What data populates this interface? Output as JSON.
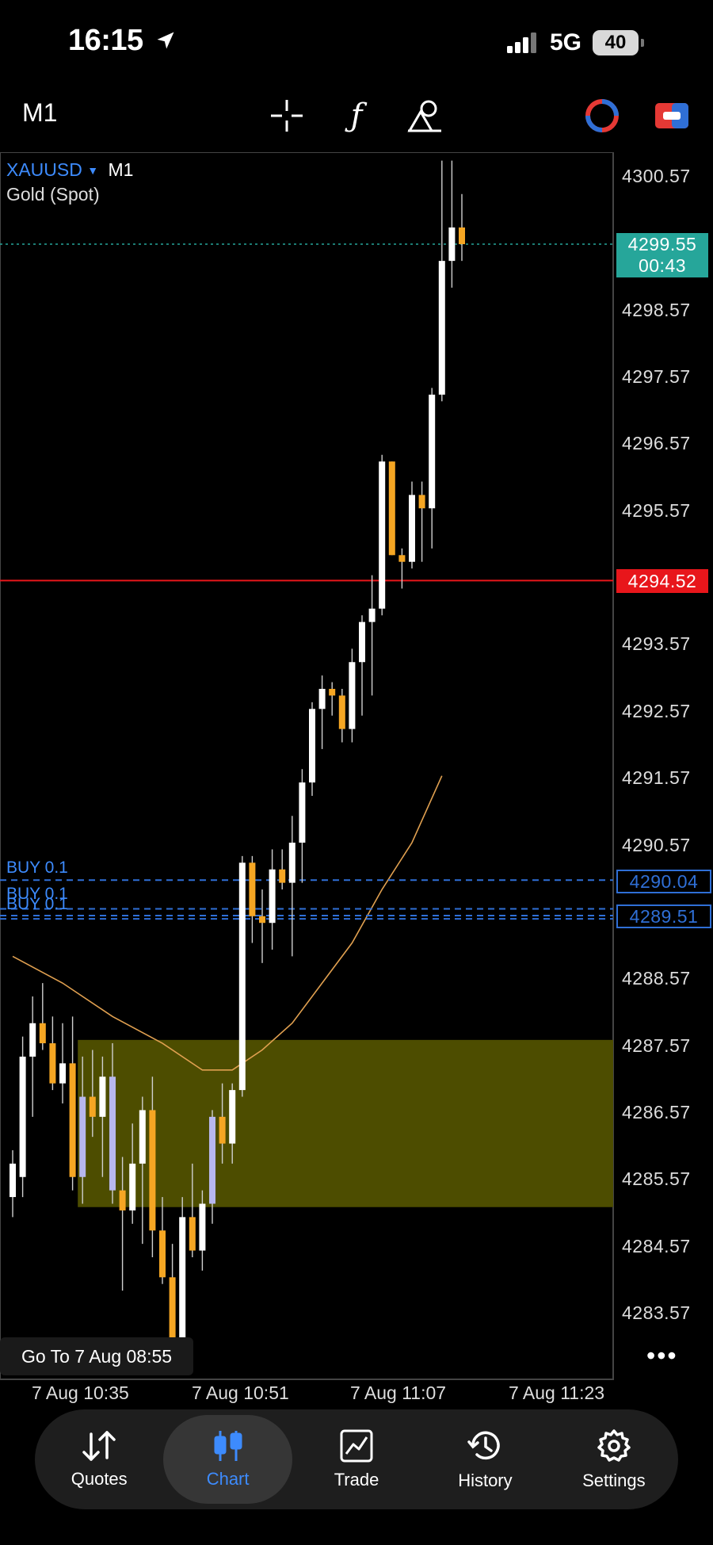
{
  "status_bar": {
    "time": "16:15",
    "network": "5G",
    "battery": "40"
  },
  "toolbar": {
    "timeframe": "M1"
  },
  "chart": {
    "symbol": "XAUUSD",
    "symbol_timeframe": "M1",
    "description": "Gold (Spot)",
    "bid_price": "4299.55",
    "countdown": "00:43",
    "red_line_price": "4294.52",
    "order_price_1": "4290.04",
    "order_price_2": "4289.51",
    "buy_labels": [
      "BUY 0.1",
      "BUY 0.1",
      "BUY 0.1"
    ],
    "goto_label": "Go To 7 Aug 08:55",
    "y_labels": [
      "4300.57",
      "4298.57",
      "4297.57",
      "4296.57",
      "4295.57",
      "4293.57",
      "4292.57",
      "4291.57",
      "4290.57",
      "4288.57",
      "4287.57",
      "4286.57",
      "4285.57",
      "4284.57",
      "4283.57"
    ],
    "x_labels": [
      "7 Aug 10:35",
      "7 Aug 10:51",
      "7 Aug 11:07",
      "7 Aug 11:23"
    ],
    "colors": {
      "bull": "#ffffff",
      "bear": "#f5a623",
      "neutral": "#b7b7ee",
      "zone": "#4d4d00",
      "red_line": "#e8161b",
      "bid_line": "#26a69a",
      "order_line": "#2f6fd6"
    }
  },
  "chart_data": {
    "type": "candlestick",
    "symbol": "XAUUSD",
    "timeframe": "M1",
    "ylim": [
      4283.0,
      4301.2
    ],
    "candles": [
      {
        "o": 4285.3,
        "h": 4286.0,
        "l": 4285.0,
        "c": 4285.8
      },
      {
        "o": 4285.6,
        "h": 4287.7,
        "l": 4285.3,
        "c": 4287.4
      },
      {
        "o": 4287.4,
        "h": 4288.3,
        "l": 4286.5,
        "c": 4287.9
      },
      {
        "o": 4287.9,
        "h": 4288.5,
        "l": 4287.5,
        "c": 4287.6
      },
      {
        "o": 4287.6,
        "h": 4288.0,
        "l": 4286.9,
        "c": 4287.0
      },
      {
        "o": 4287.0,
        "h": 4287.9,
        "l": 4286.7,
        "c": 4287.3
      },
      {
        "o": 4287.3,
        "h": 4288.0,
        "l": 4285.4,
        "c": 4285.6
      },
      {
        "o": 4285.6,
        "h": 4287.4,
        "l": 4285.2,
        "c": 4286.8
      },
      {
        "o": 4286.8,
        "h": 4287.5,
        "l": 4286.2,
        "c": 4286.5
      },
      {
        "o": 4286.5,
        "h": 4287.4,
        "l": 4285.6,
        "c": 4287.1
      },
      {
        "o": 4287.1,
        "h": 4287.6,
        "l": 4285.2,
        "c": 4285.4
      },
      {
        "o": 4285.4,
        "h": 4285.9,
        "l": 4283.9,
        "c": 4285.1
      },
      {
        "o": 4285.1,
        "h": 4286.4,
        "l": 4284.9,
        "c": 4285.8
      },
      {
        "o": 4285.8,
        "h": 4286.8,
        "l": 4284.6,
        "c": 4286.6
      },
      {
        "o": 4286.6,
        "h": 4287.1,
        "l": 4284.4,
        "c": 4284.8
      },
      {
        "o": 4284.8,
        "h": 4285.3,
        "l": 4284.0,
        "c": 4284.1
      },
      {
        "o": 4284.1,
        "h": 4284.6,
        "l": 4283.0,
        "c": 4283.2
      },
      {
        "o": 4283.2,
        "h": 4285.3,
        "l": 4283.0,
        "c": 4285.0
      },
      {
        "o": 4285.0,
        "h": 4285.8,
        "l": 4284.4,
        "c": 4284.5
      },
      {
        "o": 4284.5,
        "h": 4285.4,
        "l": 4284.2,
        "c": 4285.2
      },
      {
        "o": 4285.2,
        "h": 4286.6,
        "l": 4284.9,
        "c": 4286.5
      },
      {
        "o": 4286.5,
        "h": 4287.0,
        "l": 4285.8,
        "c": 4286.1
      },
      {
        "o": 4286.1,
        "h": 4287.0,
        "l": 4285.8,
        "c": 4286.9
      },
      {
        "o": 4286.9,
        "h": 4290.4,
        "l": 4286.8,
        "c": 4290.3
      },
      {
        "o": 4290.3,
        "h": 4290.4,
        "l": 4289.1,
        "c": 4289.5
      },
      {
        "o": 4289.5,
        "h": 4289.9,
        "l": 4288.8,
        "c": 4289.4
      },
      {
        "o": 4289.4,
        "h": 4290.5,
        "l": 4289.0,
        "c": 4290.2
      },
      {
        "o": 4290.2,
        "h": 4290.5,
        "l": 4289.9,
        "c": 4290.0
      },
      {
        "o": 4290.0,
        "h": 4291.0,
        "l": 4288.9,
        "c": 4290.6
      },
      {
        "o": 4290.6,
        "h": 4291.7,
        "l": 4290.0,
        "c": 4291.5
      },
      {
        "o": 4291.5,
        "h": 4292.7,
        "l": 4291.3,
        "c": 4292.6
      },
      {
        "o": 4292.6,
        "h": 4293.1,
        "l": 4292.0,
        "c": 4292.9
      },
      {
        "o": 4292.9,
        "h": 4293.0,
        "l": 4292.5,
        "c": 4292.8
      },
      {
        "o": 4292.8,
        "h": 4292.9,
        "l": 4292.1,
        "c": 4292.3
      },
      {
        "o": 4292.3,
        "h": 4293.5,
        "l": 4292.1,
        "c": 4293.3
      },
      {
        "o": 4293.3,
        "h": 4294.0,
        "l": 4292.5,
        "c": 4293.9
      },
      {
        "o": 4293.9,
        "h": 4294.6,
        "l": 4292.8,
        "c": 4294.1
      },
      {
        "o": 4294.1,
        "h": 4296.4,
        "l": 4294.0,
        "c": 4296.3
      },
      {
        "o": 4296.3,
        "h": 4296.3,
        "l": 4294.9,
        "c": 4294.9
      },
      {
        "o": 4294.9,
        "h": 4295.0,
        "l": 4294.4,
        "c": 4294.8
      },
      {
        "o": 4294.8,
        "h": 4296.0,
        "l": 4294.7,
        "c": 4295.8
      },
      {
        "o": 4295.8,
        "h": 4296.0,
        "l": 4294.8,
        "c": 4295.6
      },
      {
        "o": 4295.6,
        "h": 4297.4,
        "l": 4295.0,
        "c": 4297.3
      },
      {
        "o": 4297.3,
        "h": 4300.8,
        "l": 4297.2,
        "c": 4299.3
      },
      {
        "o": 4299.3,
        "h": 4300.8,
        "l": 4298.9,
        "c": 4299.8
      },
      {
        "o": 4299.8,
        "h": 4300.3,
        "l": 4299.3,
        "c": 4299.55
      }
    ],
    "moving_average": [
      {
        "i": 0,
        "v": 4288.9
      },
      {
        "i": 5,
        "v": 4288.5
      },
      {
        "i": 10,
        "v": 4288.0
      },
      {
        "i": 15,
        "v": 4287.6
      },
      {
        "i": 19,
        "v": 4287.2
      },
      {
        "i": 22,
        "v": 4287.2
      },
      {
        "i": 25,
        "v": 4287.5
      },
      {
        "i": 28,
        "v": 4287.9
      },
      {
        "i": 31,
        "v": 4288.5
      },
      {
        "i": 34,
        "v": 4289.1
      },
      {
        "i": 37,
        "v": 4289.9
      },
      {
        "i": 40,
        "v": 4290.6
      },
      {
        "i": 43,
        "v": 4291.6
      }
    ],
    "zone": {
      "from_index": 7,
      "y_top": 4287.65,
      "y_bottom": 4285.15
    },
    "bid": 4299.55,
    "red_line": 4294.52,
    "orders": [
      4290.04,
      4289.51
    ]
  },
  "nav": {
    "items": [
      {
        "label": "Quotes"
      },
      {
        "label": "Chart"
      },
      {
        "label": "Trade"
      },
      {
        "label": "History"
      },
      {
        "label": "Settings"
      }
    ]
  }
}
